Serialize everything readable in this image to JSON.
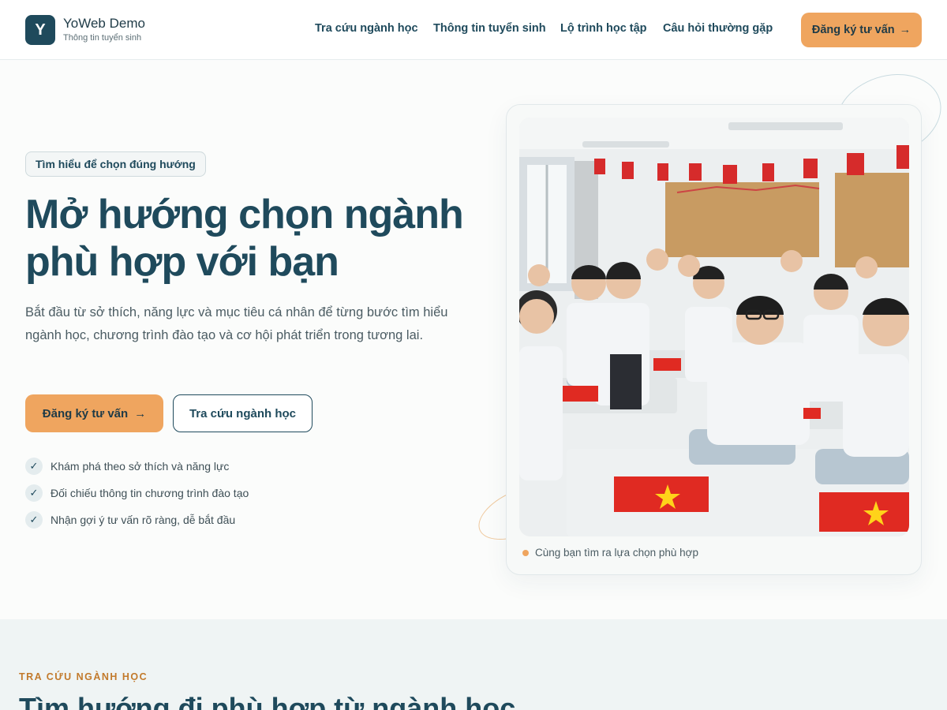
{
  "brand": {
    "logo_letter": "Y",
    "name": "YoWeb Demo",
    "subtitle": "Thông tin tuyển sinh"
  },
  "nav": {
    "items": [
      {
        "label": "Tra cứu ngành học"
      },
      {
        "label": "Thông tin tuyển sinh"
      },
      {
        "label": "Lộ trình học tập"
      },
      {
        "label": "Câu hỏi thường gặp"
      }
    ],
    "cta_label": "Đăng ký tư vấn",
    "cta_arrow": "→"
  },
  "hero": {
    "eyebrow": "Tìm hiểu để chọn đúng hướng",
    "title_line1": "Mở hướng chọn ngành",
    "title_line2": "phù hợp với bạn",
    "description": "Bắt đầu từ sở thích, năng lực và mục tiêu cá nhân để từng bước tìm hiểu ngành học, chương trình đào tạo và cơ hội phát triển trong tương lai.",
    "primary_button": "Đăng ký tư vấn",
    "primary_arrow": "→",
    "secondary_button": "Tra cứu ngành học",
    "checks": [
      {
        "icon": "check-icon",
        "mark": "✓",
        "text": "Khám phá theo sở thích và năng lực"
      },
      {
        "icon": "check-icon",
        "mark": "✓",
        "text": "Đối chiếu thông tin chương trình đào tạo"
      },
      {
        "icon": "check-icon",
        "mark": "✓",
        "text": "Nhận gợi ý tư vấn rõ ràng, dễ bắt đầu"
      }
    ],
    "image_caption": "Cùng bạn tìm ra lựa chọn phù hợp"
  },
  "section": {
    "eyebrow": "TRA CỨU NGÀNH HỌC",
    "title": "Tìm hướng đi phù hợp từ ngành học"
  },
  "colors": {
    "primary": "#1f4a5c",
    "accent": "#efa55f",
    "background": "#fbfcfb",
    "section_background": "#eff4f4"
  }
}
